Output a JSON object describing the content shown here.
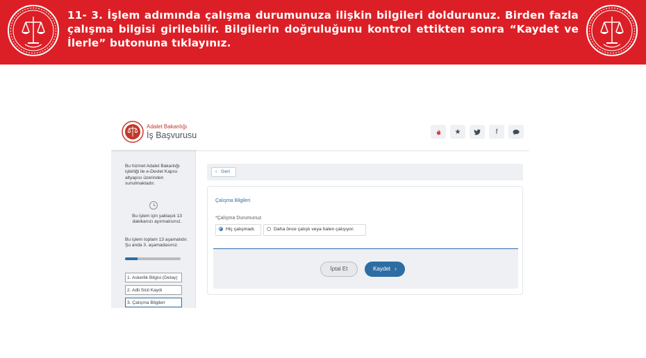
{
  "banner": {
    "text": "11- 3. İşlem adımında çalışma durumunuza ilişkin bilgileri doldurunuz. Birden fazla çalışma bilgisi girilebilir. Bilgilerin doğruluğunu kontrol ettikten sonra “Kaydet ve İlerle” butonuna tıklayınız."
  },
  "header": {
    "org_name": "Adalet Bakanlığı",
    "app_name": "İş Başvurusu",
    "social_icons": [
      "flame-icon",
      "star-icon",
      "twitter-icon",
      "facebook-icon",
      "chat-icon"
    ]
  },
  "sidebar": {
    "intro_text": "Bu hizmet Adalet Bakanlığı işbirliği ile e-Devlet Kapısı altyapısı üzerinden sunulmaktadır.",
    "time_text": "Bu işlem için yaklaşık 13 dakikanızı ayırmalısınız.",
    "steps_info_text": "Bu işlem toplam 13 aşamalıdır. Şu anda 3. aşamadasınız.",
    "progress": 0.23,
    "steps": [
      {
        "label": "1. Askerlik Bilgisi (Detay)"
      },
      {
        "label": "2. Adli Sicil Kaydı"
      },
      {
        "label": "3. Çalışma Bilgileri"
      }
    ]
  },
  "main": {
    "back_label": "Geri",
    "card_title": "Çalışma Bilgileri",
    "field_label": "*Çalışma Durumunuz",
    "options": [
      {
        "label": "Hiç çalışmadı.",
        "selected": true
      },
      {
        "label": "Daha önce çalıştı veya halen çalışıyor.",
        "selected": false
      }
    ],
    "cancel_label": "İptal Et",
    "save_label": "Kaydet"
  },
  "colors": {
    "banner_red": "#dc1f26",
    "primary_blue": "#2e6da4",
    "panel_gray": "#eef0f3"
  }
}
